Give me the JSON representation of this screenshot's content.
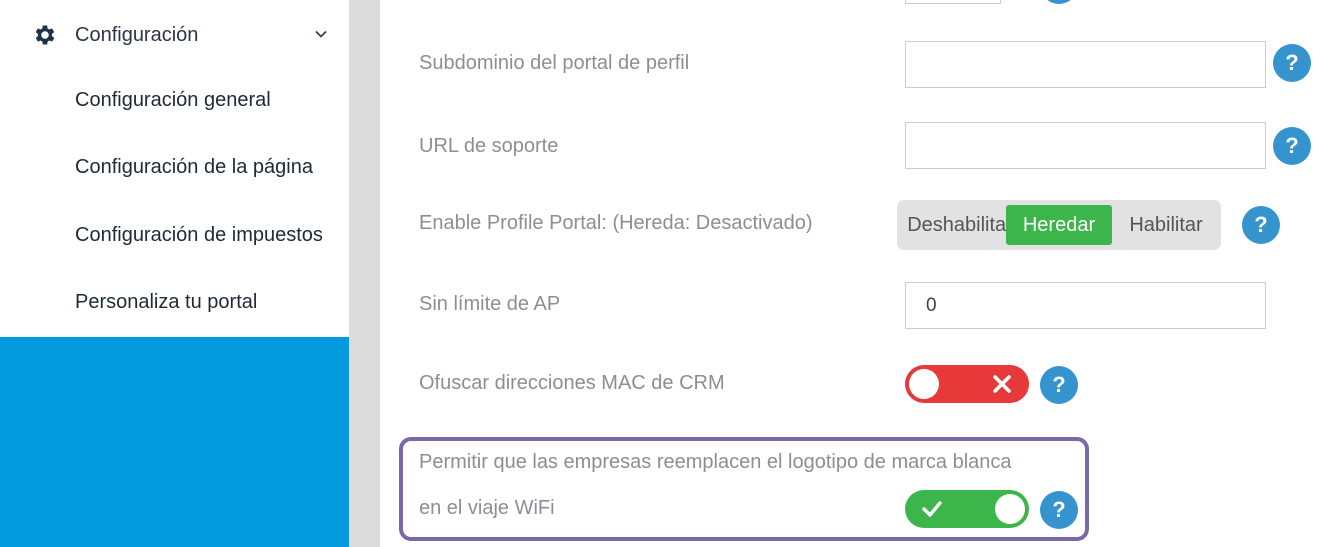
{
  "sidebar": {
    "section_title": "Configuración",
    "items": [
      {
        "label": "Configuración general"
      },
      {
        "label": "Configuración de la página"
      },
      {
        "label": "Configuración de impuestos"
      },
      {
        "label": "Personaliza tu portal"
      }
    ]
  },
  "settings": {
    "profile_subdomain": {
      "label": "Subdominio del portal de perfil",
      "value": ""
    },
    "support_url": {
      "label": "URL de soporte",
      "value": ""
    },
    "enable_profile_portal": {
      "label": "Enable Profile Portal: (Hereda: Desactivado)",
      "options": [
        "Deshabilitar",
        "Heredar",
        "Habilitar"
      ],
      "selected": "Heredar"
    },
    "unlimited_ap": {
      "label": "Sin límite de AP",
      "value": "0"
    },
    "obfuscate_mac": {
      "label": "Ofuscar direcciones MAC de CRM",
      "enabled": false
    },
    "white_label_logo": {
      "label_line1": "Permitir que las empresas reemplacen el logotipo de marca blanca",
      "label_line2": "en el viaje WiFi",
      "enabled": true
    },
    "help_symbol": "?"
  },
  "colors": {
    "accent_blue": "#0299dd",
    "help_blue": "#3594cd",
    "active_green": "#3cb54a",
    "off_red": "#e8393a",
    "highlight_purple": "#7c68a8"
  }
}
